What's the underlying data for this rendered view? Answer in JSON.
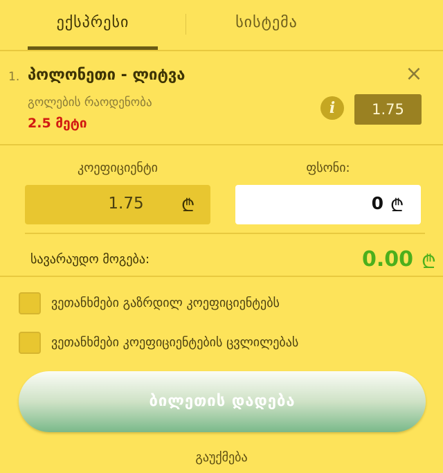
{
  "tabs": {
    "express": "ექსპრესი",
    "system": "სისტემა"
  },
  "event": {
    "number": "1.",
    "title": "პოლონეთი - ლიტვა",
    "market": "გოლების რაოდენობა",
    "selection": "2.5 მეტი",
    "odd": "1.75"
  },
  "labels": {
    "coefficient": "კოეფიციენტი",
    "stake": "ფსონი:"
  },
  "inputs": {
    "coefficient_value": "1.75",
    "stake_value": "0",
    "currency": "₾"
  },
  "win": {
    "label": "სავარაუდო მოგება:",
    "value": "0.00"
  },
  "options": [
    "ვეთანხმები გაზრდილ კოეფიციენტებს",
    "ვეთანხმები კოეფიციენტების ცვლილებას"
  ],
  "actions": {
    "submit": "ბილეთის დადება",
    "cancel": "გაუქმება"
  },
  "icons": {
    "close": "close-icon",
    "info": "info-icon"
  },
  "colors": {
    "background": "#fde35a",
    "selection": "#d11a12",
    "win": "#4caf1c",
    "odd_badge": "#9a8122"
  }
}
